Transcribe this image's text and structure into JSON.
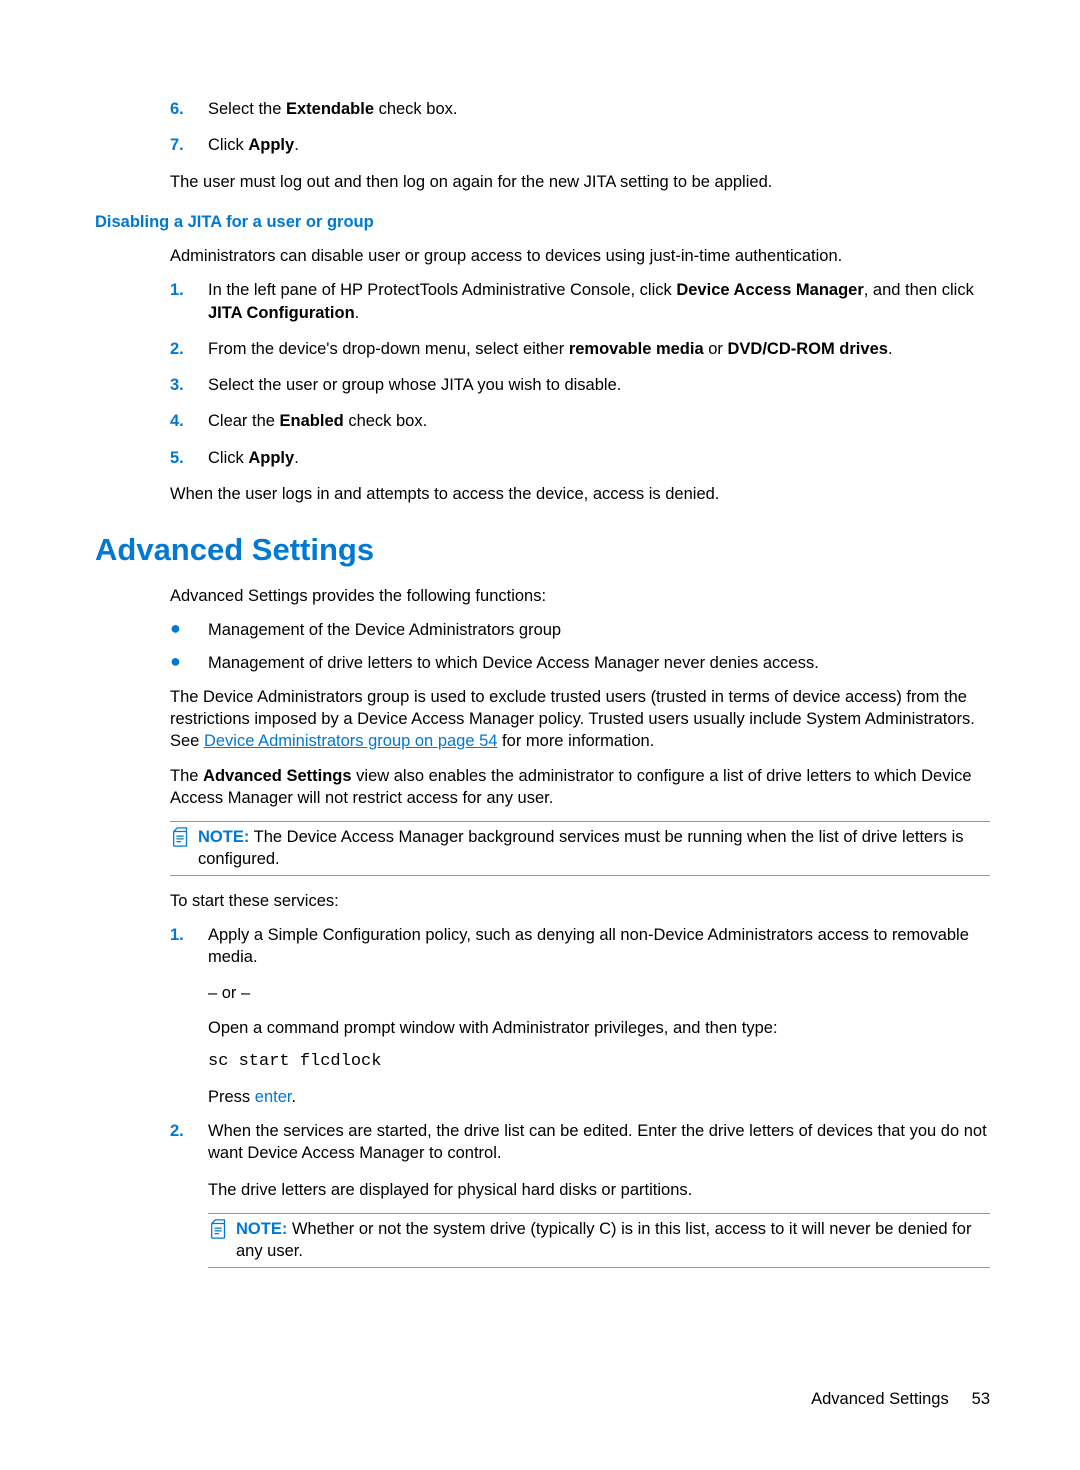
{
  "top_list": {
    "n6": "6.",
    "i6_pre": "Select the ",
    "i6_b": "Extendable",
    "i6_post": " check box.",
    "n7": "7.",
    "i7_pre": "Click ",
    "i7_b": "Apply",
    "i7_post": "."
  },
  "top_para": "The user must log out and then log on again for the new JITA setting to be applied.",
  "h4": "Disabling a JITA for a user or group",
  "disable_intro": "Administrators can disable user or group access to devices using just-in-time authentication.",
  "disable_list": {
    "n1": "1.",
    "i1_pre": "In the left pane of HP ProtectTools Administrative Console, click ",
    "i1_b1": "Device Access Manager",
    "i1_mid": ", and then click ",
    "i1_b2": "JITA Configuration",
    "i1_post": ".",
    "n2": "2.",
    "i2_pre": "From the device's drop-down menu, select either ",
    "i2_b1": "removable media",
    "i2_mid": " or ",
    "i2_b2": "DVD/CD-ROM drives",
    "i2_post": ".",
    "n3": "3.",
    "i3": "Select the user or group whose JITA you wish to disable.",
    "n4": "4.",
    "i4_pre": "Clear the ",
    "i4_b": "Enabled",
    "i4_post": " check box.",
    "n5": "5.",
    "i5_pre": "Click ",
    "i5_b": "Apply",
    "i5_post": "."
  },
  "disable_outro": "When the user logs in and attempts to access the device, access is denied.",
  "h1": "Advanced Settings",
  "adv_intro": "Advanced Settings provides the following functions:",
  "adv_bullets": {
    "b1": "Management of the Device Administrators group",
    "b2": "Management of drive letters to which Device Access Manager never denies access."
  },
  "adv_p1_pre": "The Device Administrators group is used to exclude trusted users (trusted in terms of device access) from the restrictions imposed by a Device Access Manager policy. Trusted users usually include System Administrators. See ",
  "adv_p1_link": "Device Administrators group on page 54",
  "adv_p1_post": " for more information.",
  "adv_p2_pre": "The ",
  "adv_p2_b": "Advanced Settings",
  "adv_p2_post": " view also enables the administrator to configure a list of drive letters to which Device Access Manager will not restrict access for any user.",
  "note1_label": "NOTE:",
  "note1_text": "The Device Access Manager background services must be running when the list of drive letters is configured.",
  "start_intro": "To start these services:",
  "start_list": {
    "n1": "1.",
    "i1": "Apply a Simple Configuration policy, such as denying all non-Device Administrators access to removable media.",
    "or": "– or –",
    "open": "Open a command prompt window with Administrator privileges, and then type:",
    "cmd": "sc start flcdlock",
    "press_pre": "Press ",
    "press_key": "enter",
    "press_post": ".",
    "n2": "2.",
    "i2": "When the services are started, the drive list can be edited. Enter the drive letters of devices that you do not want Device Access Manager to control.",
    "drive": "The drive letters are displayed for physical hard disks or partitions."
  },
  "note2_label": "NOTE:",
  "note2_text": "Whether or not the system drive (typically C) is in this list, access to it will never be denied for any user.",
  "footer_section": "Advanced Settings",
  "footer_page": "53"
}
